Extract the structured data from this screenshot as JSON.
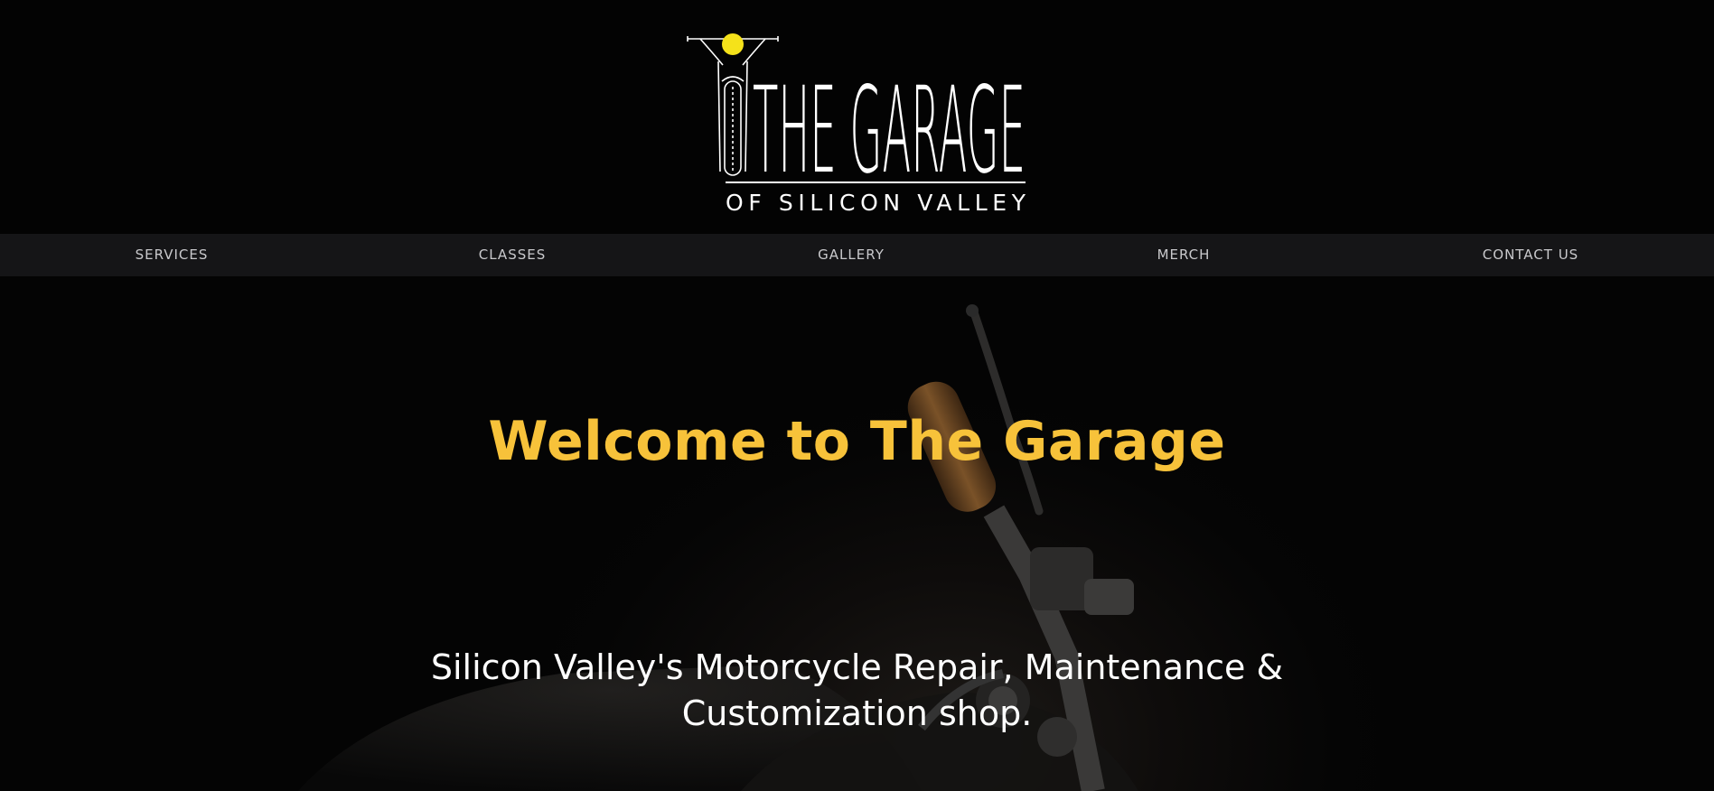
{
  "logo": {
    "title": "THE GARAGE",
    "subtitle": "OF SILICON VALLEY"
  },
  "nav": {
    "items": [
      {
        "label": "SERVICES"
      },
      {
        "label": "CLASSES"
      },
      {
        "label": "GALLERY"
      },
      {
        "label": "MERCH"
      },
      {
        "label": "CONTACT US"
      }
    ]
  },
  "hero": {
    "title": "Welcome to The Garage",
    "subtitle": "Silicon Valley's Motorcycle Repair, Maintenance & Customization shop."
  },
  "colors": {
    "accent": "#f7c23a",
    "nav_background": "#151517",
    "page_background": "#000000",
    "headlight": "#f5e21a"
  },
  "icons": {
    "logo_mark": "motorcycle-front-icon"
  }
}
